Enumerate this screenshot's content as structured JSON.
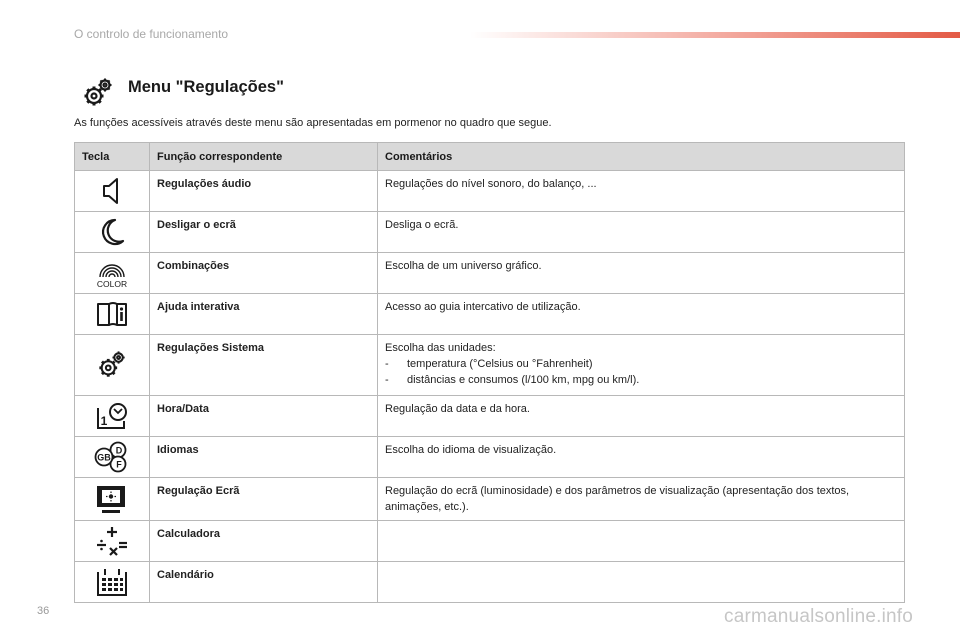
{
  "header": {
    "section": "O controlo de funcionamento"
  },
  "title": "Menu \"Regulações\"",
  "intro": "As funções acessíveis através deste menu são apresentadas em pormenor no quadro que segue.",
  "table": {
    "headers": {
      "key": "Tecla",
      "function": "Função correspondente",
      "comments": "Comentários"
    },
    "rows": [
      {
        "icon": "speaker-icon",
        "function": "Regulações áudio",
        "comment": "Regulações do nível sonoro, do balanço, ..."
      },
      {
        "icon": "moon-icon",
        "function": "Desligar o ecrã",
        "comment": "Desliga o ecrã."
      },
      {
        "icon": "color-palette-icon",
        "icon_label": "COLOR",
        "function": "Combinações",
        "comment": "Escolha de um universo gráfico."
      },
      {
        "icon": "info-book-icon",
        "function": "Ajuda interativa",
        "comment": "Acesso ao guia intercativo de utilização."
      },
      {
        "icon": "gears-icon",
        "function": "Regulações Sistema",
        "comment": "Escolha das unidades:",
        "items": [
          "temperatura (°Celsius ou °Fahrenheit)",
          "distâncias e consumos (l/100 km, mpg ou km/l)."
        ]
      },
      {
        "icon": "clock-calendar-icon",
        "icon_label": "1",
        "function": "Hora/Data",
        "comment": "Regulação da data e da hora."
      },
      {
        "icon": "languages-icon",
        "icon_labels": [
          "GB",
          "D",
          "F"
        ],
        "function": "Idiomas",
        "comment": "Escolha do idioma de visualização."
      },
      {
        "icon": "screen-brightness-icon",
        "function": "Regulação Ecrã",
        "comment": "Regulação do ecrã (luminosidade) e dos parâmetros de visualização (apresentação dos textos, animações, etc.)."
      },
      {
        "icon": "calculator-icon",
        "function": "Calculadora",
        "comment": ""
      },
      {
        "icon": "calendar-icon",
        "function": "Calendário",
        "comment": ""
      }
    ]
  },
  "page_number": "36",
  "watermark": "carmanualsonline.info",
  "colors": {
    "accent": "#e35a45",
    "table_header_bg": "#d9d9d9",
    "border": "#b8b8b8"
  }
}
